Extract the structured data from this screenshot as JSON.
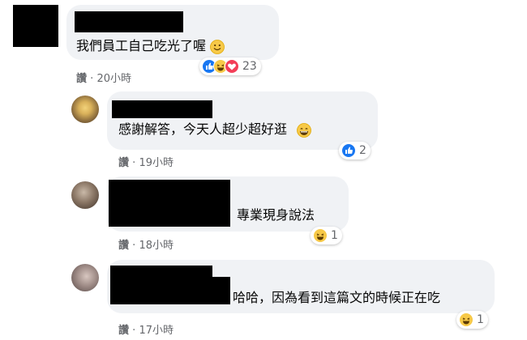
{
  "comments": [
    {
      "text": "我們員工自己吃光了喔",
      "like_label": "讚",
      "time": "20小時",
      "separator": "·",
      "reaction_count": "23",
      "reaction_icons": [
        "like-icon",
        "haha-icon",
        "love-icon"
      ],
      "inline_emoji": "smile-emoji"
    },
    {
      "text": "感謝解答，今天人超少超好逛",
      "like_label": "讚",
      "time": "19小時",
      "separator": "·",
      "reaction_count": "2",
      "reaction_icons": [
        "like-icon"
      ],
      "inline_emoji": "grin-emoji"
    },
    {
      "text": "專業現身說法",
      "like_label": "讚",
      "time": "18小時",
      "separator": "·",
      "reaction_count": "1",
      "reaction_icons": [
        "haha-icon"
      ]
    },
    {
      "text": "哈哈，因為看到這篇文的時候正在吃",
      "like_label": "讚",
      "time": "17小時",
      "separator": "·",
      "reaction_count": "1",
      "reaction_icons": [
        "haha-icon"
      ]
    }
  ],
  "colors": {
    "bubble": "#f0f2f5",
    "meta_text": "#65676b",
    "like_blue": "#1877f2",
    "love_red": "#f33e58",
    "haha_yellow": "#f7c948"
  }
}
